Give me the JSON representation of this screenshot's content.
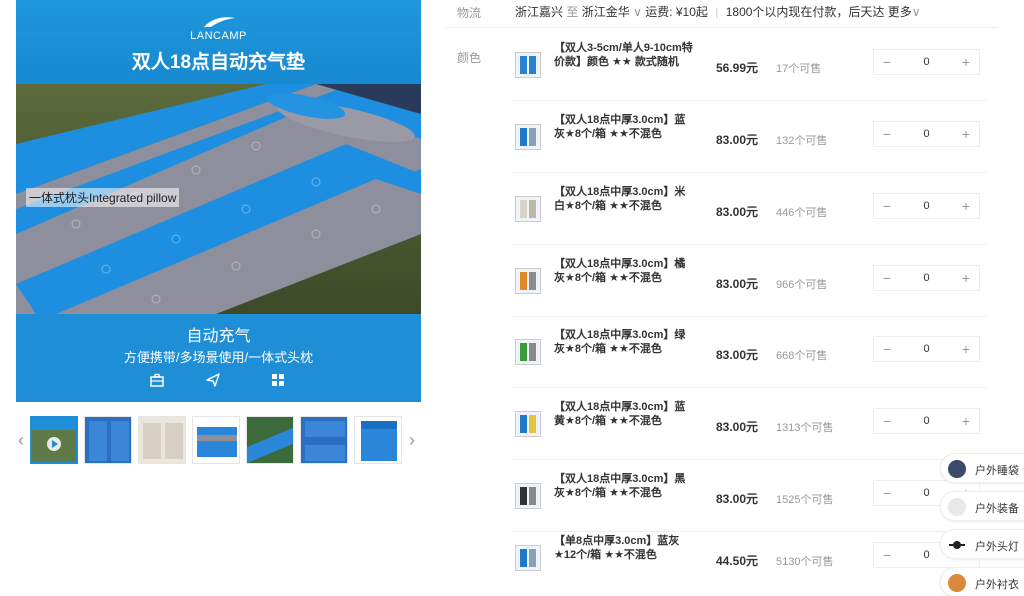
{
  "gallery": {
    "logo_text": "LANCAMP",
    "title": "双人18点自动充气垫",
    "pillow_label": "一体式枕头Integrated pillow",
    "subtitle": "自动充气",
    "subtitle2": "方便携带/多场景使用/一体式头枕",
    "icons": [
      "briefcase-icon",
      "paper-plane-icon",
      "grid-icon"
    ],
    "prev_arrow": "‹",
    "next_arrow": "›",
    "thumb_count": 7,
    "selected_thumb": 0
  },
  "logistics": {
    "label": "物流",
    "from": "浙江嘉兴",
    "to_word": "至",
    "to": "浙江金华",
    "shipping": "运费: ¥10起",
    "delivery": "1800个以内现在付款，后天达",
    "more": "更多"
  },
  "color_label": "颜色",
  "skus": [
    {
      "name": "【双人3-5cm/单人9-10cm特价款】颜色 ★★ 款式随机",
      "price": "56.99元",
      "stock": "17个可售",
      "qty": "0",
      "color1": "#2a7fd0",
      "color2": "#2a7fd0"
    },
    {
      "name": "【双人18点中厚3.0cm】蓝灰★8个/箱 ★★不混色",
      "price": "83.00元",
      "stock": "132个可售",
      "qty": "0",
      "color1": "#1f79c9",
      "color2": "#8aa0b8"
    },
    {
      "name": "【双人18点中厚3.0cm】米白★8个/箱 ★★不混色",
      "price": "83.00元",
      "stock": "446个可售",
      "qty": "0",
      "color1": "#d9d3c6",
      "color2": "#bfb8a9"
    },
    {
      "name": "【双人18点中厚3.0cm】橘灰★8个/箱 ★★不混色",
      "price": "83.00元",
      "stock": "966个可售",
      "qty": "0",
      "color1": "#e2892a",
      "color2": "#8c8c8c"
    },
    {
      "name": "【双人18点中厚3.0cm】绿灰★8个/箱 ★★不混色",
      "price": "83.00元",
      "stock": "668个可售",
      "qty": "0",
      "color1": "#3a9a3c",
      "color2": "#8a8a8a"
    },
    {
      "name": "【双人18点中厚3.0cm】蓝黄★8个/箱 ★★不混色",
      "price": "83.00元",
      "stock": "1313个可售",
      "qty": "0",
      "color1": "#1f79c9",
      "color2": "#e6c33a"
    },
    {
      "name": "【双人18点中厚3.0cm】黑灰★8个/箱 ★★不混色",
      "price": "83.00元",
      "stock": "1525个可售",
      "qty": "0",
      "color1": "#333333",
      "color2": "#8a8a8a"
    },
    {
      "name": "【单8点中厚3.0cm】蓝灰★12个/箱 ★★不混色",
      "price": "44.50元",
      "stock": "5130个可售",
      "qty": "0",
      "color1": "#1f79c9",
      "color2": "#8aa0b8"
    }
  ],
  "stepper": {
    "minus": "−",
    "plus": "+"
  },
  "related": [
    {
      "label": "户外睡袋",
      "icon": "sleeping-bag-icon",
      "color": "#3a4a6a"
    },
    {
      "label": "户外装备",
      "icon": "gear-blank-icon",
      "color": "#e8e8e8"
    },
    {
      "label": "户外头灯",
      "icon": "headlamp-icon",
      "color": "#222222"
    },
    {
      "label": "户外衬衣",
      "icon": "shirt-icon",
      "color": "#d98a3a"
    }
  ],
  "colors": {
    "brand_blue": "#1a8fd6",
    "stripe_gray": "#8e8f9c"
  }
}
